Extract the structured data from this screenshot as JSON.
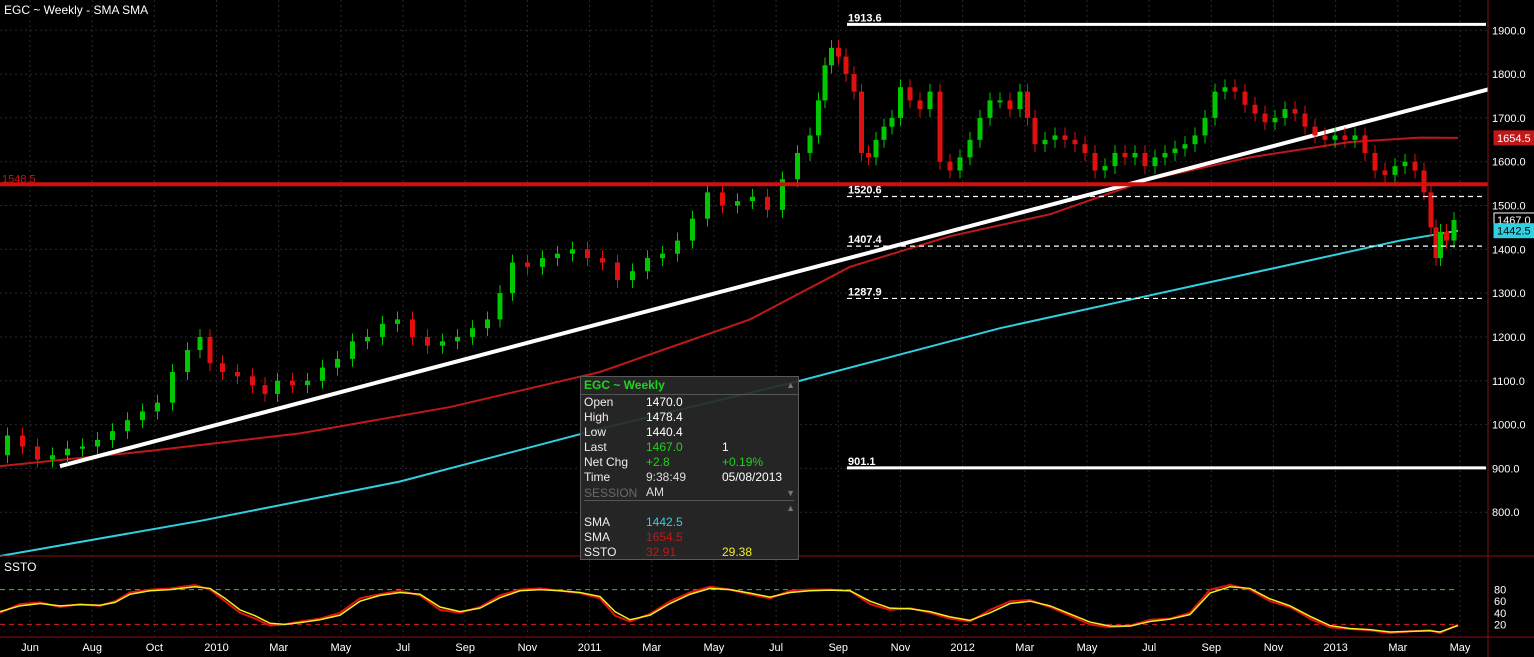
{
  "chart_title": "EGC ~ Weekly  -  SMA SMA",
  "oscillator_title": "SSTO",
  "colors": {
    "up": "#00c800",
    "down": "#e01010",
    "sma_short": "#30d0e0",
    "sma_long": "#c01818",
    "hline_red": "#d01010",
    "ssto_k": "#e01010",
    "ssto_d": "#f0f020",
    "level_top": "#20d020",
    "level_bottom": "#e02020"
  },
  "chart_data": {
    "type": "candlestick",
    "x_ticks": [
      "Jun",
      "Aug",
      "Oct",
      "2010",
      "Mar",
      "May",
      "Jul",
      "Sep",
      "Nov",
      "2011",
      "Mar",
      "May",
      "Jul",
      "Sep",
      "Nov",
      "2012",
      "Mar",
      "May",
      "Jul",
      "Sep",
      "Nov",
      "2013",
      "Mar",
      "May"
    ],
    "y_ticks": [
      800,
      900,
      1000,
      1100,
      1200,
      1300,
      1400,
      1500,
      1600,
      1700,
      1800,
      1900
    ],
    "ylim": [
      700,
      1960
    ],
    "osc_ticks": [
      20,
      40,
      60,
      80
    ],
    "osc_ylim": [
      0,
      100
    ],
    "levels": [
      {
        "value": 1913.6,
        "label": "1913.6",
        "style": "solid"
      },
      {
        "value": 1520.6,
        "label": "1520.6",
        "style": "dashed"
      },
      {
        "value": 1407.4,
        "label": "1407.4",
        "style": "dashed"
      },
      {
        "value": 1287.9,
        "label": "1287.9",
        "style": "dashed"
      },
      {
        "value": 901.1,
        "label": "901.1",
        "style": "solid"
      }
    ],
    "red_level": {
      "value": 1548.5,
      "label": "1548.5"
    },
    "price_badges": [
      {
        "label": "1654.5",
        "value": 1654.5
      },
      {
        "label": "1467.0",
        "value": 1467.0
      },
      {
        "label": "1442.5",
        "value": 1442.5
      }
    ],
    "close_path": [
      [
        0,
        930
      ],
      [
        15,
        975
      ],
      [
        30,
        950
      ],
      [
        45,
        920
      ],
      [
        60,
        930
      ],
      [
        75,
        945
      ],
      [
        90,
        950
      ],
      [
        105,
        965
      ],
      [
        120,
        985
      ],
      [
        135,
        1010
      ],
      [
        150,
        1030
      ],
      [
        165,
        1050
      ],
      [
        180,
        1120
      ],
      [
        195,
        1170
      ],
      [
        205,
        1200
      ],
      [
        215,
        1140
      ],
      [
        230,
        1120
      ],
      [
        245,
        1110
      ],
      [
        260,
        1090
      ],
      [
        270,
        1070
      ],
      [
        285,
        1100
      ],
      [
        300,
        1090
      ],
      [
        315,
        1100
      ],
      [
        330,
        1130
      ],
      [
        345,
        1150
      ],
      [
        360,
        1190
      ],
      [
        375,
        1200
      ],
      [
        390,
        1230
      ],
      [
        405,
        1240
      ],
      [
        420,
        1200
      ],
      [
        435,
        1180
      ],
      [
        450,
        1190
      ],
      [
        465,
        1200
      ],
      [
        480,
        1220
      ],
      [
        495,
        1240
      ],
      [
        505,
        1300
      ],
      [
        520,
        1370
      ],
      [
        535,
        1360
      ],
      [
        550,
        1380
      ],
      [
        565,
        1390
      ],
      [
        580,
        1400
      ],
      [
        595,
        1380
      ],
      [
        610,
        1370
      ],
      [
        625,
        1330
      ],
      [
        640,
        1350
      ],
      [
        655,
        1380
      ],
      [
        670,
        1390
      ],
      [
        685,
        1420
      ],
      [
        700,
        1470
      ],
      [
        715,
        1530
      ],
      [
        730,
        1500
      ],
      [
        745,
        1510
      ],
      [
        760,
        1520
      ],
      [
        775,
        1490
      ],
      [
        790,
        1560
      ],
      [
        805,
        1620
      ],
      [
        815,
        1660
      ],
      [
        822,
        1740
      ],
      [
        828,
        1820
      ],
      [
        835,
        1860
      ],
      [
        842,
        1840
      ],
      [
        850,
        1800
      ],
      [
        858,
        1760
      ],
      [
        865,
        1620
      ],
      [
        872,
        1610
      ],
      [
        880,
        1650
      ],
      [
        888,
        1680
      ],
      [
        896,
        1700
      ],
      [
        905,
        1770
      ],
      [
        915,
        1740
      ],
      [
        925,
        1720
      ],
      [
        935,
        1760
      ],
      [
        945,
        1600
      ],
      [
        955,
        1580
      ],
      [
        965,
        1610
      ],
      [
        975,
        1650
      ],
      [
        985,
        1700
      ],
      [
        995,
        1740
      ],
      [
        1005,
        1740
      ],
      [
        1015,
        1720
      ],
      [
        1025,
        1760
      ],
      [
        1030,
        1700
      ],
      [
        1040,
        1640
      ],
      [
        1050,
        1650
      ],
      [
        1060,
        1660
      ],
      [
        1070,
        1650
      ],
      [
        1080,
        1640
      ],
      [
        1090,
        1620
      ],
      [
        1100,
        1580
      ],
      [
        1110,
        1590
      ],
      [
        1120,
        1620
      ],
      [
        1130,
        1610
      ],
      [
        1140,
        1620
      ],
      [
        1150,
        1590
      ],
      [
        1160,
        1610
      ],
      [
        1170,
        1620
      ],
      [
        1180,
        1630
      ],
      [
        1190,
        1640
      ],
      [
        1200,
        1660
      ],
      [
        1210,
        1700
      ],
      [
        1220,
        1760
      ],
      [
        1230,
        1770
      ],
      [
        1240,
        1760
      ],
      [
        1250,
        1730
      ],
      [
        1260,
        1710
      ],
      [
        1270,
        1690
      ],
      [
        1280,
        1700
      ],
      [
        1290,
        1720
      ],
      [
        1300,
        1710
      ],
      [
        1310,
        1680
      ],
      [
        1320,
        1660
      ],
      [
        1330,
        1650
      ],
      [
        1340,
        1660
      ],
      [
        1350,
        1650
      ],
      [
        1360,
        1660
      ],
      [
        1370,
        1620
      ],
      [
        1380,
        1580
      ],
      [
        1390,
        1570
      ],
      [
        1400,
        1590
      ],
      [
        1410,
        1600
      ],
      [
        1420,
        1580
      ],
      [
        1428,
        1530
      ],
      [
        1434,
        1450
      ],
      [
        1438,
        1380
      ],
      [
        1443,
        1440
      ],
      [
        1450,
        1420
      ],
      [
        1458,
        1467
      ]
    ],
    "sma_short_path": [
      [
        0,
        700
      ],
      [
        200,
        780
      ],
      [
        400,
        870
      ],
      [
        600,
        990
      ],
      [
        800,
        1100
      ],
      [
        1000,
        1220
      ],
      [
        1200,
        1320
      ],
      [
        1300,
        1370
      ],
      [
        1400,
        1420
      ],
      [
        1458,
        1442.5
      ]
    ],
    "sma_long_path": [
      [
        0,
        905
      ],
      [
        150,
        940
      ],
      [
        300,
        980
      ],
      [
        450,
        1040
      ],
      [
        600,
        1120
      ],
      [
        750,
        1240
      ],
      [
        850,
        1360
      ],
      [
        950,
        1430
      ],
      [
        1050,
        1480
      ],
      [
        1150,
        1560
      ],
      [
        1250,
        1610
      ],
      [
        1350,
        1645
      ],
      [
        1420,
        1655
      ],
      [
        1458,
        1654.5
      ]
    ],
    "white_trendline": [
      [
        60,
        905
      ],
      [
        1488,
        1765
      ]
    ],
    "ssto_k": [
      [
        0,
        40
      ],
      [
        20,
        55
      ],
      [
        40,
        58
      ],
      [
        60,
        50
      ],
      [
        80,
        55
      ],
      [
        100,
        52
      ],
      [
        115,
        60
      ],
      [
        130,
        75
      ],
      [
        150,
        80
      ],
      [
        170,
        82
      ],
      [
        195,
        88
      ],
      [
        210,
        80
      ],
      [
        225,
        60
      ],
      [
        240,
        40
      ],
      [
        255,
        30
      ],
      [
        270,
        18
      ],
      [
        285,
        20
      ],
      [
        300,
        25
      ],
      [
        320,
        30
      ],
      [
        340,
        40
      ],
      [
        360,
        65
      ],
      [
        380,
        72
      ],
      [
        400,
        78
      ],
      [
        420,
        70
      ],
      [
        440,
        45
      ],
      [
        460,
        40
      ],
      [
        480,
        50
      ],
      [
        500,
        70
      ],
      [
        520,
        80
      ],
      [
        540,
        82
      ],
      [
        560,
        78
      ],
      [
        580,
        74
      ],
      [
        600,
        65
      ],
      [
        615,
        35
      ],
      [
        630,
        25
      ],
      [
        650,
        38
      ],
      [
        670,
        60
      ],
      [
        690,
        75
      ],
      [
        710,
        85
      ],
      [
        730,
        80
      ],
      [
        750,
        72
      ],
      [
        770,
        65
      ],
      [
        790,
        78
      ],
      [
        810,
        80
      ],
      [
        830,
        80
      ],
      [
        850,
        78
      ],
      [
        870,
        55
      ],
      [
        890,
        45
      ],
      [
        910,
        48
      ],
      [
        930,
        40
      ],
      [
        950,
        30
      ],
      [
        970,
        25
      ],
      [
        990,
        45
      ],
      [
        1010,
        60
      ],
      [
        1030,
        62
      ],
      [
        1050,
        50
      ],
      [
        1070,
        35
      ],
      [
        1090,
        20
      ],
      [
        1110,
        15
      ],
      [
        1130,
        18
      ],
      [
        1150,
        28
      ],
      [
        1170,
        30
      ],
      [
        1190,
        40
      ],
      [
        1210,
        80
      ],
      [
        1230,
        88
      ],
      [
        1250,
        80
      ],
      [
        1270,
        60
      ],
      [
        1290,
        50
      ],
      [
        1310,
        30
      ],
      [
        1330,
        15
      ],
      [
        1350,
        12
      ],
      [
        1370,
        10
      ],
      [
        1390,
        5
      ],
      [
        1410,
        8
      ],
      [
        1430,
        10
      ],
      [
        1440,
        5
      ],
      [
        1458,
        20
      ]
    ],
    "ssto_d": [
      [
        0,
        42
      ],
      [
        20,
        52
      ],
      [
        40,
        56
      ],
      [
        60,
        52
      ],
      [
        80,
        54
      ],
      [
        100,
        53
      ],
      [
        115,
        58
      ],
      [
        130,
        72
      ],
      [
        150,
        78
      ],
      [
        170,
        80
      ],
      [
        195,
        85
      ],
      [
        210,
        82
      ],
      [
        225,
        65
      ],
      [
        240,
        45
      ],
      [
        255,
        35
      ],
      [
        270,
        22
      ],
      [
        285,
        20
      ],
      [
        300,
        23
      ],
      [
        320,
        28
      ],
      [
        340,
        36
      ],
      [
        360,
        60
      ],
      [
        380,
        70
      ],
      [
        400,
        75
      ],
      [
        420,
        72
      ],
      [
        440,
        50
      ],
      [
        460,
        42
      ],
      [
        480,
        48
      ],
      [
        500,
        66
      ],
      [
        520,
        78
      ],
      [
        540,
        80
      ],
      [
        560,
        78
      ],
      [
        580,
        75
      ],
      [
        600,
        68
      ],
      [
        615,
        42
      ],
      [
        630,
        28
      ],
      [
        650,
        36
      ],
      [
        670,
        56
      ],
      [
        690,
        72
      ],
      [
        710,
        82
      ],
      [
        730,
        80
      ],
      [
        750,
        74
      ],
      [
        770,
        67
      ],
      [
        790,
        75
      ],
      [
        810,
        78
      ],
      [
        830,
        79
      ],
      [
        850,
        78
      ],
      [
        870,
        60
      ],
      [
        890,
        48
      ],
      [
        910,
        47
      ],
      [
        930,
        42
      ],
      [
        950,
        33
      ],
      [
        970,
        27
      ],
      [
        990,
        40
      ],
      [
        1010,
        56
      ],
      [
        1030,
        60
      ],
      [
        1050,
        52
      ],
      [
        1070,
        38
      ],
      [
        1090,
        24
      ],
      [
        1110,
        17
      ],
      [
        1130,
        17
      ],
      [
        1150,
        25
      ],
      [
        1170,
        29
      ],
      [
        1190,
        37
      ],
      [
        1210,
        74
      ],
      [
        1230,
        85
      ],
      [
        1250,
        82
      ],
      [
        1270,
        64
      ],
      [
        1290,
        52
      ],
      [
        1310,
        34
      ],
      [
        1330,
        18
      ],
      [
        1350,
        13
      ],
      [
        1370,
        11
      ],
      [
        1390,
        7
      ],
      [
        1410,
        8
      ],
      [
        1430,
        9
      ],
      [
        1440,
        7
      ],
      [
        1458,
        18
      ]
    ],
    "osc_levels": [
      80,
      20
    ]
  },
  "panel": {
    "title": "EGC ~ Weekly",
    "rows": [
      {
        "label": "Open",
        "v1": "1470.0",
        "v2": ""
      },
      {
        "label": "High",
        "v1": "1478.4",
        "v2": ""
      },
      {
        "label": "Low",
        "v1": "1440.4",
        "v2": ""
      },
      {
        "label": "Last",
        "v1": "1467.0",
        "v2": "1"
      },
      {
        "label": "Net Chg",
        "v1": "+2.8",
        "v2": "+0.19%"
      },
      {
        "label": "Time",
        "v1": "9:38:49 AM",
        "v2": "05/08/2013"
      }
    ],
    "section": "SESSION",
    "indicators": [
      {
        "label": "SMA",
        "v1": "1442.5",
        "v2": ""
      },
      {
        "label": "SMA",
        "v1": "1654.5",
        "v2": ""
      },
      {
        "label": "SSTO",
        "v1": "32.91",
        "v2": "29.38"
      }
    ]
  }
}
